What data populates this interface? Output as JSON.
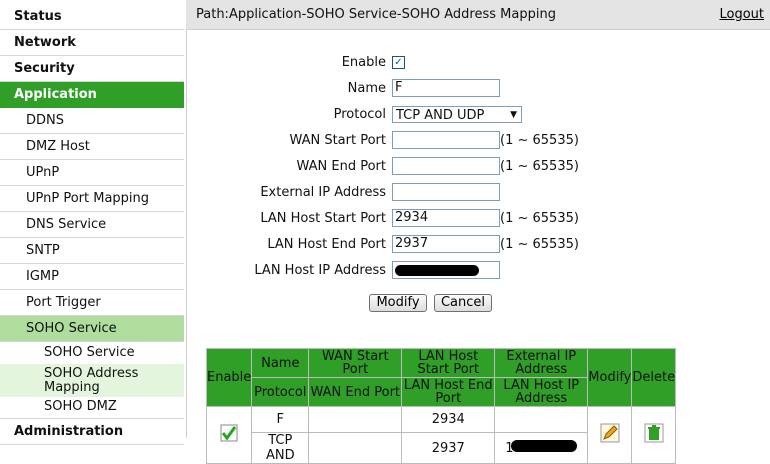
{
  "header": {
    "path": "Path:Application-SOHO Service-SOHO Address Mapping",
    "logout": "Logout"
  },
  "sidebar": {
    "status": "Status",
    "network": "Network",
    "security": "Security",
    "application": "Application",
    "items": [
      "DDNS",
      "DMZ Host",
      "UPnP",
      "UPnP Port Mapping",
      "DNS Service",
      "SNTP",
      "IGMP",
      "Port Trigger",
      "SOHO Service"
    ],
    "soho": {
      "service": "SOHO Service",
      "address_mapping": "SOHO Address Mapping",
      "dmz": "SOHO DMZ"
    },
    "administration": "Administration"
  },
  "form": {
    "enable_label": "Enable",
    "enable_checked": true,
    "name_label": "Name",
    "name_value": "F",
    "protocol_label": "Protocol",
    "protocol_value": "TCP AND UDP",
    "wan_start_label": "WAN Start Port",
    "wan_start_value": "",
    "wan_end_label": "WAN End Port",
    "wan_end_value": "",
    "ext_ip_label": "External IP Address",
    "ext_ip_value": "",
    "lan_start_label": "LAN Host Start Port",
    "lan_start_value": "2934",
    "lan_end_label": "LAN Host End Port",
    "lan_end_value": "2937",
    "lan_ip_label": "LAN Host IP Address",
    "range_hint": "(1 ~ 65535)",
    "modify": "Modify",
    "cancel": "Cancel"
  },
  "table": {
    "enable": "Enable",
    "name": "Name",
    "protocol": "Protocol",
    "wan_start": "WAN Start Port",
    "wan_end": "WAN End Port",
    "lan_start": "LAN Host Start Port",
    "lan_end": "LAN Host End Port",
    "ext_ip": "External IP Address",
    "lan_ip": "LAN Host IP Address",
    "modify": "Modify",
    "delete": "Delete",
    "row": {
      "name": "F",
      "protocol": "TCP AND",
      "lan_start": "2934",
      "lan_end": "2937",
      "lan_ip_prefix": "1"
    }
  },
  "colors": {
    "accent": "#2f9f28",
    "sub_active": "#aedd9e",
    "subsub_active": "#e3f5dc"
  }
}
